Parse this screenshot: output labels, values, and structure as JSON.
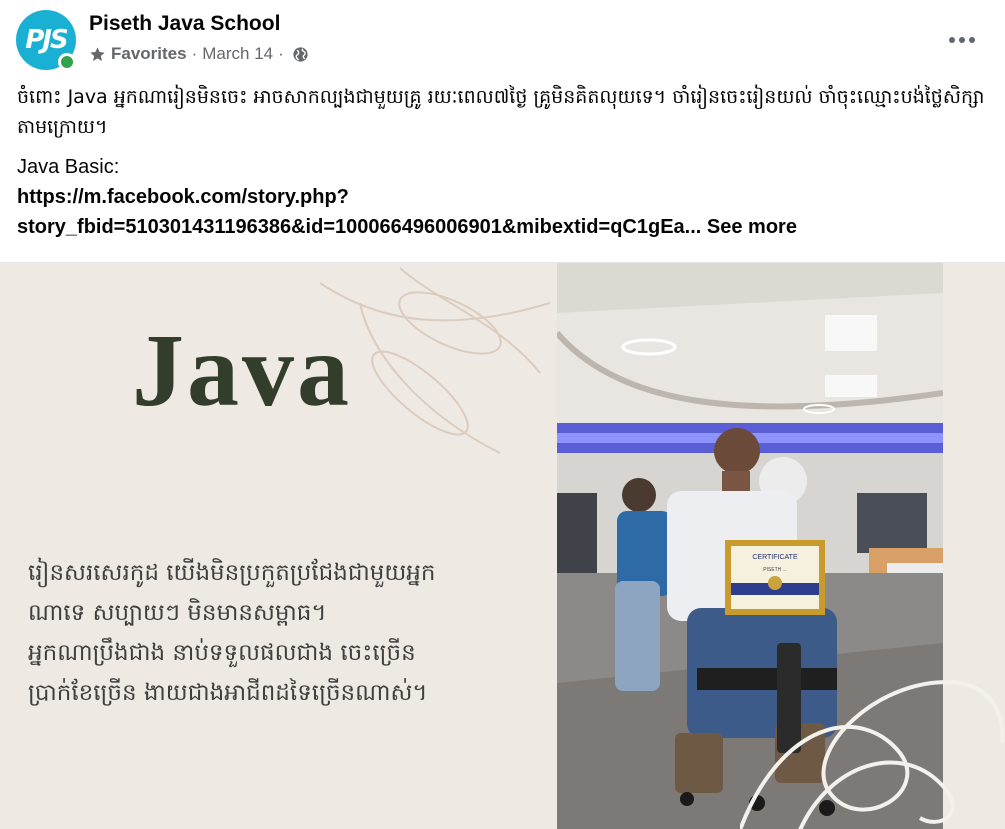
{
  "header": {
    "page_name": "Piseth Java School",
    "avatar_text": "PJS",
    "favorites_label": "Favorites",
    "separator": "·",
    "date": "March 14",
    "star_icon": "star-icon",
    "globe_icon": "globe-icon",
    "more_icon": "more-options-icon"
  },
  "post": {
    "khmer_text": "ចំពោះ Java អ្នកណារៀនមិនចេះ អាចសាកល្បងជាមួយគ្រូ រយៈពេល៧ថ្ងៃ គ្រូមិនគិតលុយទេ។ ចាំរៀនចេះរៀនយល់ ចាំចុះឈ្មោះបង់ថ្លៃសិក្សាតាមក្រោយ។",
    "label": "Java Basic:",
    "link_line1": "https://m.facebook.com/story.php?",
    "link_line2": "story_fbid=510301431196386&id=100066496006901&mibextid=qC1gEa...",
    "see_more": "See more"
  },
  "media": {
    "title": "Java",
    "khmer_lines": [
      "រៀនសរសេរកូដ យើងមិនប្រកួតប្រជែងជាមួយអ្នក",
      "ណាទេ សប្បាយៗ មិនមានសម្ពាធ។",
      "អ្នកណាប្រឹងជាង នាប់ទទួលផលជាង ចេះច្រើន",
      "ប្រាក់ខែច្រើន ងាយជាងអាជីពដទៃច្រើនណាស់។"
    ],
    "certificate_text": "CERTIFICATE",
    "certificate_name": "PISETH ..."
  },
  "colors": {
    "avatar_bg": "#1ab0d4",
    "online": "#31a24c",
    "media_bg": "#eeeae3",
    "java_title": "#333d2b",
    "meta_text": "#65676b"
  }
}
